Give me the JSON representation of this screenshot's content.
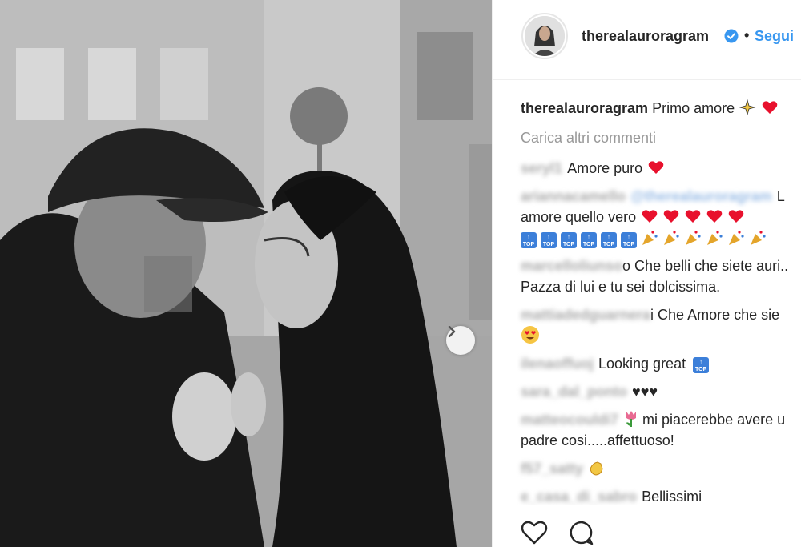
{
  "header": {
    "username": "therealauroragram",
    "separator": "•",
    "follow_label": "Segui"
  },
  "caption": {
    "username": "therealauroragram",
    "text": "Primo amore"
  },
  "load_more_label": "Carica altri commenti",
  "comments": [
    {
      "user": "seryl1",
      "text": "Amore puro"
    },
    {
      "user": "ariannacamello",
      "mention": "@therealauroragram",
      "text_line1": "L",
      "text_line2": "amore quello vero"
    },
    {
      "user": "marcelloliunso",
      "text_line1": "o Che belli che siete auri..",
      "text_line2": "Pazza di lui e tu sei dolcissima."
    },
    {
      "user": "mattiadedguarnera",
      "text_line1": "i Che Amore che sie"
    },
    {
      "user": "ilenaoffuoj",
      "text": "Looking great"
    },
    {
      "user": "sara_dal_ponto",
      "text": "♥♥♥"
    },
    {
      "user": "matteocouldi7",
      "text_line1": "mi piacerebbe avere u",
      "text_line2": "padre cosi.....affettuoso!"
    },
    {
      "user": "f57_satty",
      "text": ""
    },
    {
      "user": "e_casa_di_sabro",
      "text": "Bellissimi"
    }
  ],
  "top_badge": "TOP",
  "icons": {
    "verified": "verified-badge-icon",
    "next": "chevron-right-icon",
    "like": "heart-outline-icon",
    "comment": "comment-bubble-icon"
  },
  "colors": {
    "link_blue": "#3897f0",
    "heart_red": "#e8112d",
    "muted_gray": "#999999"
  }
}
